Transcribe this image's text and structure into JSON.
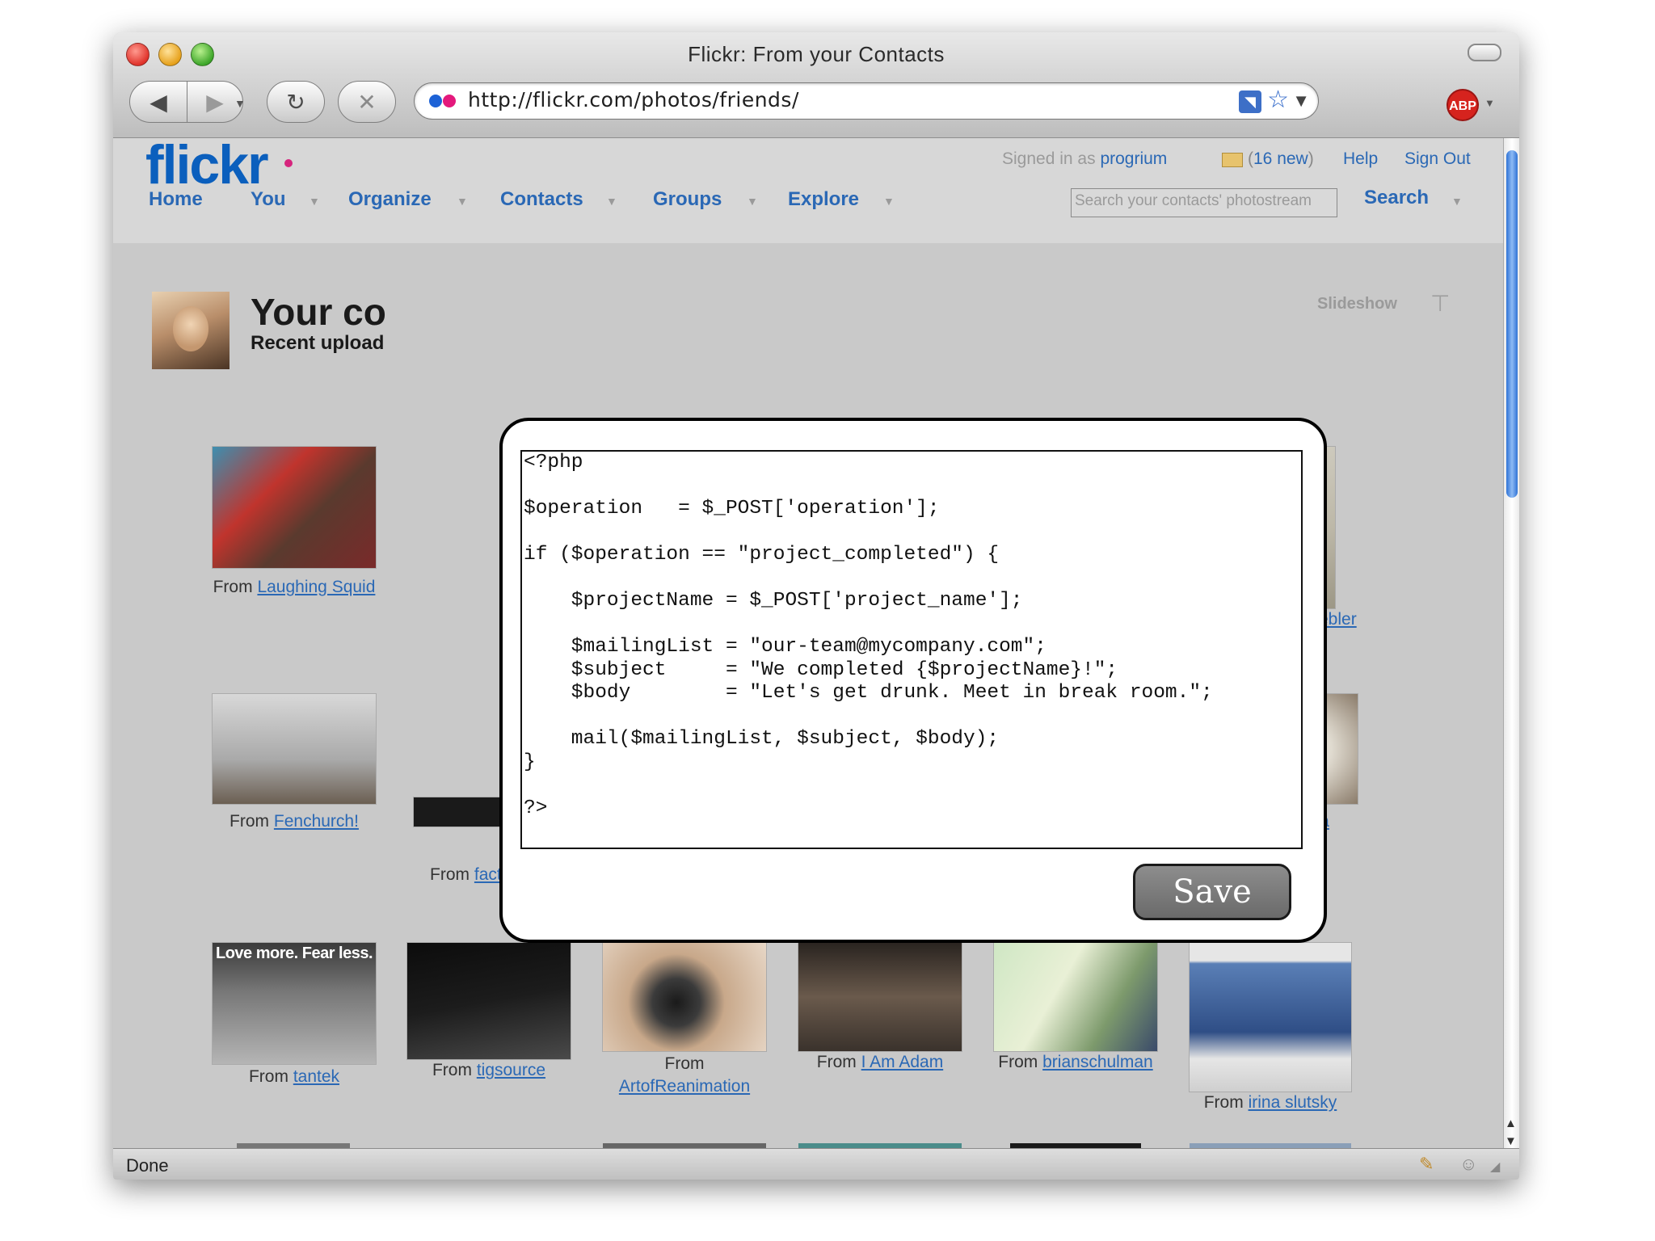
{
  "browser": {
    "window_title": "Flickr: From your Contacts",
    "url": "http://flickr.com/photos/friends/",
    "back_icon": "◀",
    "forward_icon": "▶",
    "reload_icon": "↻",
    "stop_icon": "✕",
    "adblock_label": "ABP",
    "status": "Done"
  },
  "flickr": {
    "logo": "flickr",
    "signed_in_prefix": "Signed in as",
    "username": "progrium",
    "new_messages_count": "16 new",
    "help": "Help",
    "sign_out": "Sign Out",
    "nav": {
      "home": "Home",
      "you": "You",
      "organize": "Organize",
      "contacts": "Contacts",
      "groups": "Groups",
      "explore": "Explore"
    },
    "search_placeholder": "Search your contacts' photostream",
    "search_button": "Search",
    "page_title": "Your co",
    "page_subtitle": "Recent upload",
    "slideshow": "Slideshow",
    "from_label": "From",
    "photos": [
      {
        "from": "Laughing Squid"
      },
      {
        "from": "Little Keebler"
      },
      {
        "from": "Fenchurch!"
      },
      {
        "from": "factoryjoe"
      },
      {
        "from": "ketiya"
      },
      {
        "from": "tantek",
        "overlay": "Love more. Fear less."
      },
      {
        "from": "tigsource"
      },
      {
        "from": "ArtofReanimation"
      },
      {
        "from": "I Am Adam"
      },
      {
        "from": "brianschulman"
      },
      {
        "from": "irina slutsky"
      }
    ]
  },
  "modal": {
    "code": "<?php\n\n$operation   = $_POST['operation'];\n\nif ($operation == \"project_completed\") {\n\n    $projectName = $_POST['project_name'];\n\n    $mailingList = \"our-team@mycompany.com\";\n    $subject     = \"We completed {$projectName}!\";\n    $body        = \"Let's get drunk. Meet in break room.\";\n\n    mail($mailingList, $subject, $body);\n}\n\n?>",
    "save_label": "Save"
  },
  "colors": {
    "flickr_blue": "#0b5fbd",
    "flickr_pink": "#d6247d",
    "link_blue": "#2a68b5"
  }
}
